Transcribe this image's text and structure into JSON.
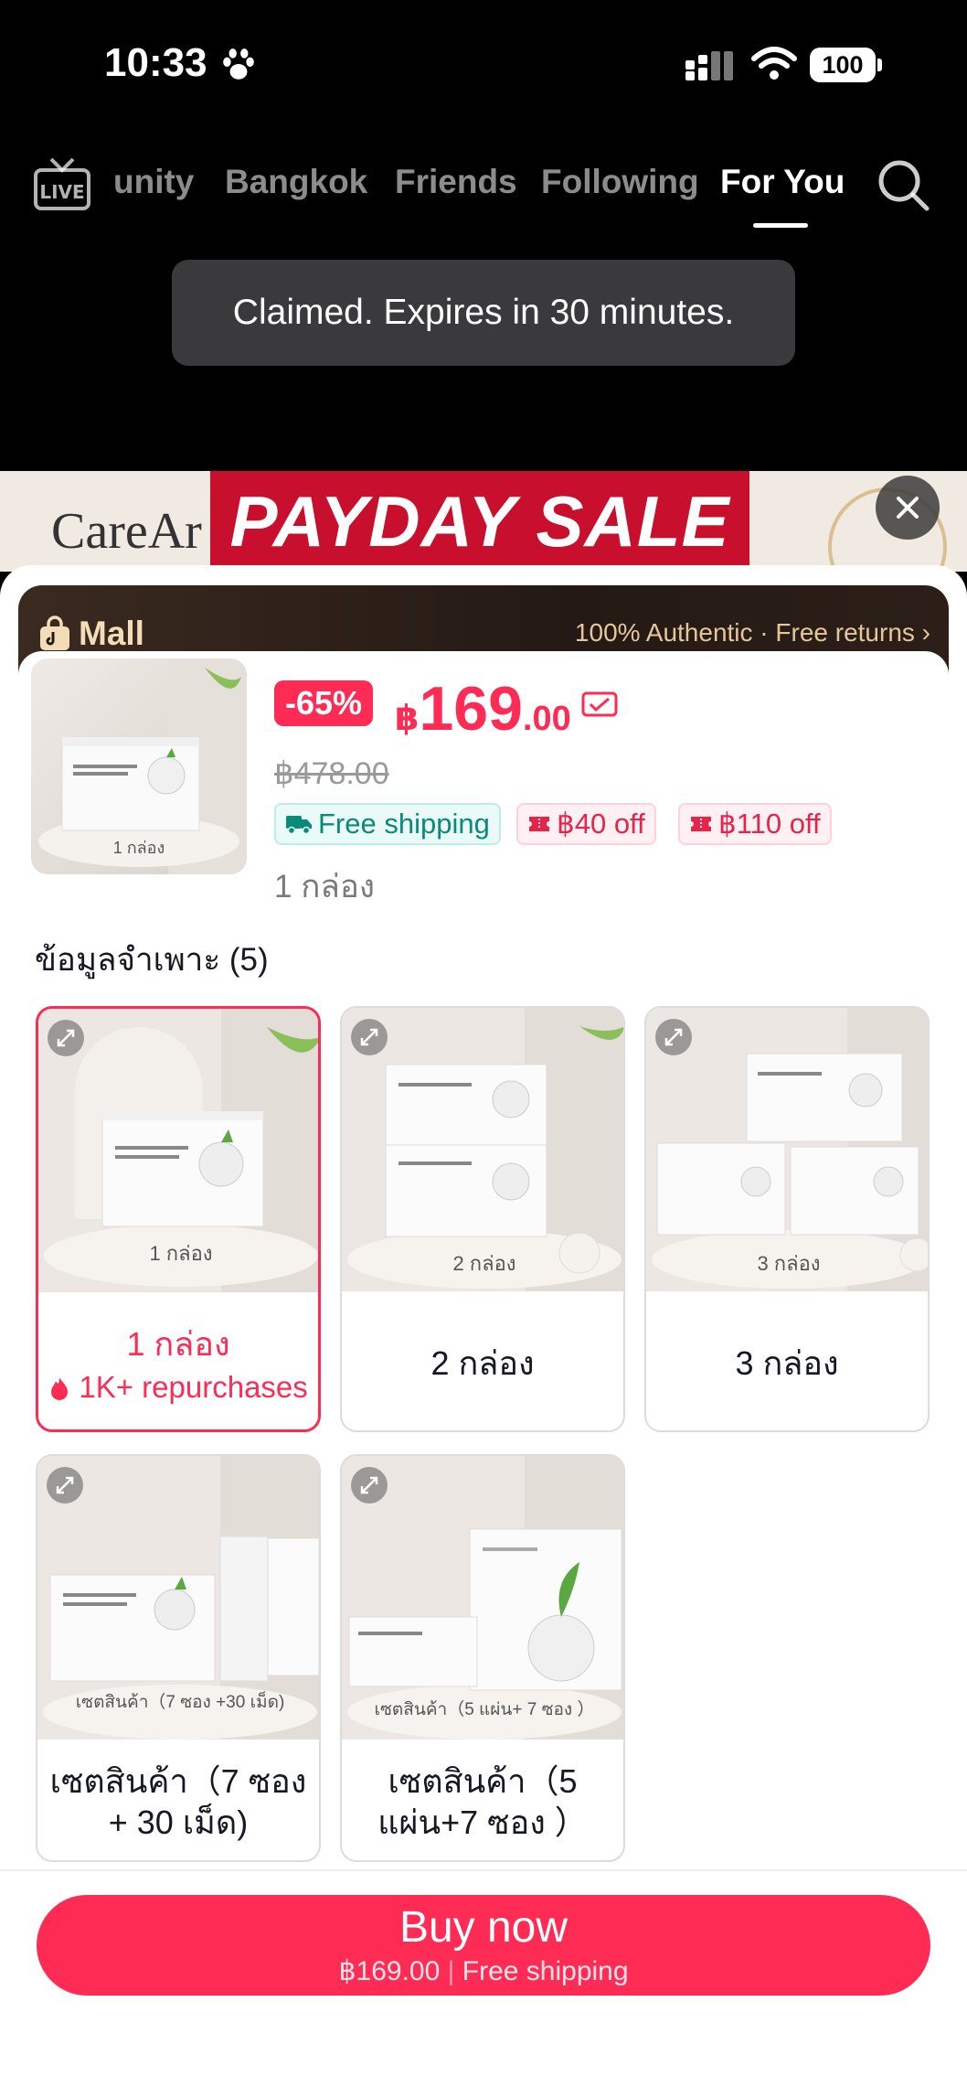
{
  "status_bar": {
    "time": "10:33",
    "battery": "100"
  },
  "nav": {
    "tabs": [
      {
        "label": "unity",
        "active": false
      },
      {
        "label": "Bangkok",
        "active": false
      },
      {
        "label": "Friends",
        "active": false
      },
      {
        "label": "Following",
        "active": false
      },
      {
        "label": "For You",
        "active": true
      }
    ],
    "live_label": "LIVE"
  },
  "toast": {
    "text": "Claimed. Expires in 30 minutes."
  },
  "banner": {
    "brand": "CareAr",
    "sale_text": "PAYDAY SALE"
  },
  "mall": {
    "label": "Mall",
    "tagline": "100% Authentic · Free returns ›"
  },
  "product": {
    "discount": "-65%",
    "currency": "฿",
    "price_whole": "169",
    "price_decimal": ".00",
    "original_price": "฿478.00",
    "free_shipping": "Free shipping",
    "coupons": [
      "฿40 off",
      "฿110 off"
    ],
    "selected_variant": "1 กล่อง",
    "thumb_caption": "1 กล่อง"
  },
  "spec": {
    "title": "ข้อมูลจำเพาะ (5)"
  },
  "variants": [
    {
      "label": "1 กล่อง",
      "img_caption": "1 กล่อง",
      "repurchase": "1K+ repurchases",
      "selected": true
    },
    {
      "label": "2 กล่อง",
      "img_caption": "2 กล่อง",
      "selected": false
    },
    {
      "label": "3 กล่อง",
      "img_caption": "3 กล่อง",
      "selected": false
    },
    {
      "label": "เซตสินค้า（7 ซอง + 30 เม็ด)",
      "img_caption": "เซตสินค้า（7 ซอง +30 เม็ด)",
      "selected": false
    },
    {
      "label": "เซตสินค้า（5 แผ่น+7 ซอง ）",
      "img_caption": "เซตสินค้า（5 แผ่น+ 7 ซอง ）",
      "selected": false
    }
  ],
  "buy": {
    "label": "Buy now",
    "price": "฿169.00",
    "shipping": "Free shipping"
  },
  "colors": {
    "accent": "#fe2c55",
    "mall_bg": "#241914",
    "ship_green": "#0a8a78"
  }
}
